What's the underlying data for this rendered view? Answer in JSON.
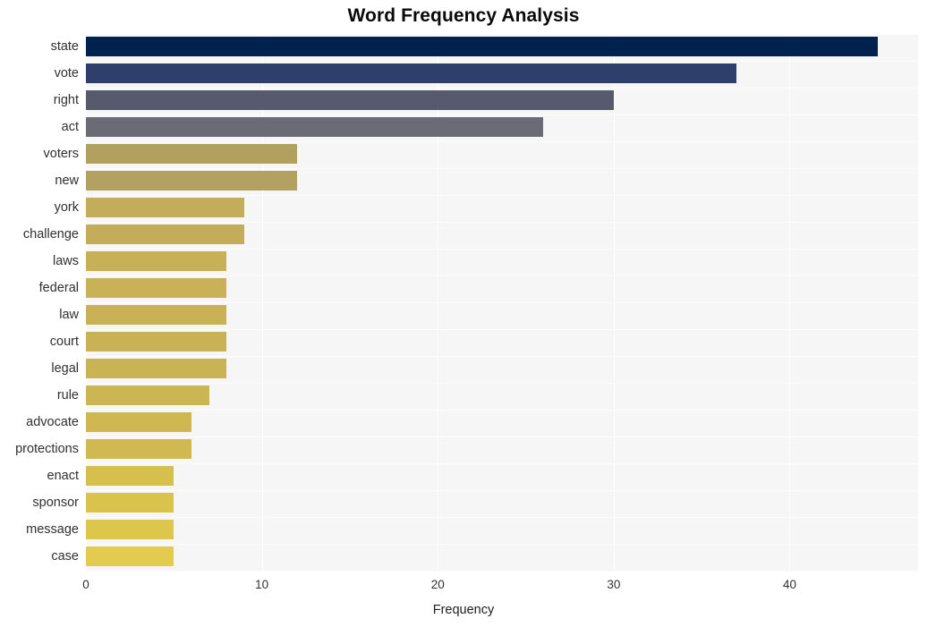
{
  "chart_data": {
    "type": "bar",
    "orientation": "horizontal",
    "title": "Word Frequency Analysis",
    "xlabel": "Frequency",
    "ylabel": "",
    "categories": [
      "state",
      "vote",
      "right",
      "act",
      "voters",
      "new",
      "york",
      "challenge",
      "laws",
      "federal",
      "law",
      "court",
      "legal",
      "rule",
      "advocate",
      "protections",
      "enact",
      "sponsor",
      "message",
      "case"
    ],
    "values": [
      45,
      37,
      30,
      26,
      12,
      12,
      9,
      9,
      8,
      8,
      8,
      8,
      8,
      7,
      6,
      6,
      5,
      5,
      5,
      5
    ],
    "bar_colors": [
      "#00224e",
      "#2e3f6b",
      "#575a6c",
      "#6a6b74",
      "#b2a061",
      "#b2a161",
      "#c3ad5b",
      "#c3ad5b",
      "#c7b158",
      "#c8b157",
      "#c9b256",
      "#c9b256",
      "#cab355",
      "#ccb653",
      "#cfb851",
      "#d0b950",
      "#d5c04e",
      "#d8c34d",
      "#dcc64c",
      "#e2cb4e"
    ],
    "xlim": [
      0,
      47.3
    ],
    "xticks": [
      0,
      10,
      20,
      30,
      40
    ],
    "xtick_labels": [
      "0",
      "10",
      "20",
      "30",
      "40"
    ],
    "grid": true,
    "grid_axis": "both",
    "legend": false,
    "plot_background": "#f6f6f6",
    "figure_background": "#ffffff",
    "gridline_color": "#ffffff"
  }
}
